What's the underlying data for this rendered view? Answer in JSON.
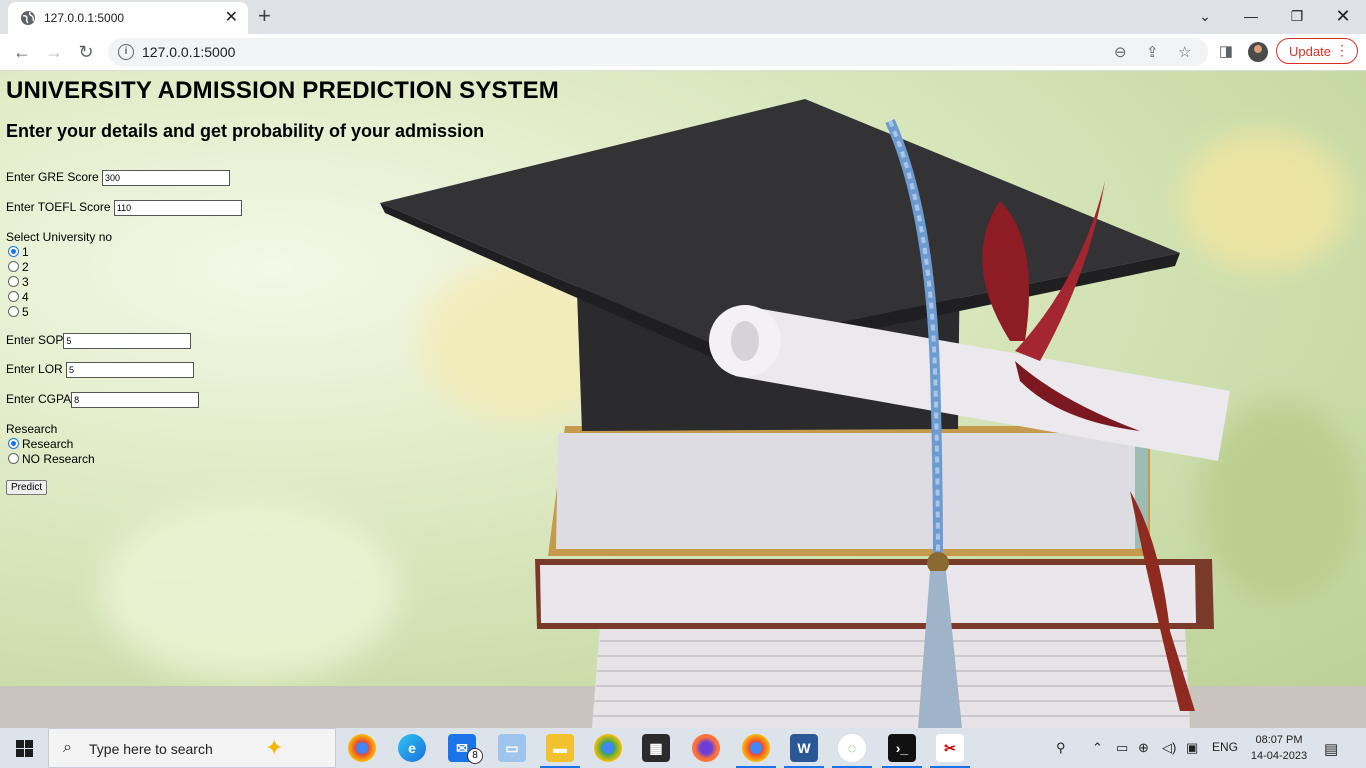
{
  "browser": {
    "tab_title": "127.0.0.1:5000",
    "url": "127.0.0.1:5000",
    "update_label": "Update"
  },
  "page": {
    "title": "UNIVERSITY ADMISSION PREDICTION SYSTEM",
    "subtitle": "Enter your details and get probability of your admission",
    "gre_label": "Enter GRE Score",
    "gre_value": "300",
    "toefl_label": "Enter TOEFL Score",
    "toefl_value": "110",
    "university_label": "Select University no",
    "university_options": [
      "1",
      "2",
      "3",
      "4",
      "5"
    ],
    "university_selected": "1",
    "sop_label": "Enter SOP",
    "sop_value": "5",
    "lor_label": "Enter LOR",
    "lor_value": "5",
    "cgpa_label": "Enter CGPA",
    "cgpa_value": "8",
    "research_label": "Research",
    "research_options": [
      "Research",
      "NO Research"
    ],
    "research_selected": "Research",
    "predict_label": "Predict"
  },
  "taskbar": {
    "search_placeholder": "Type here to search",
    "mail_badge": "8",
    "language": "ENG",
    "time": "08:07 PM",
    "date": "14-04-2023"
  }
}
